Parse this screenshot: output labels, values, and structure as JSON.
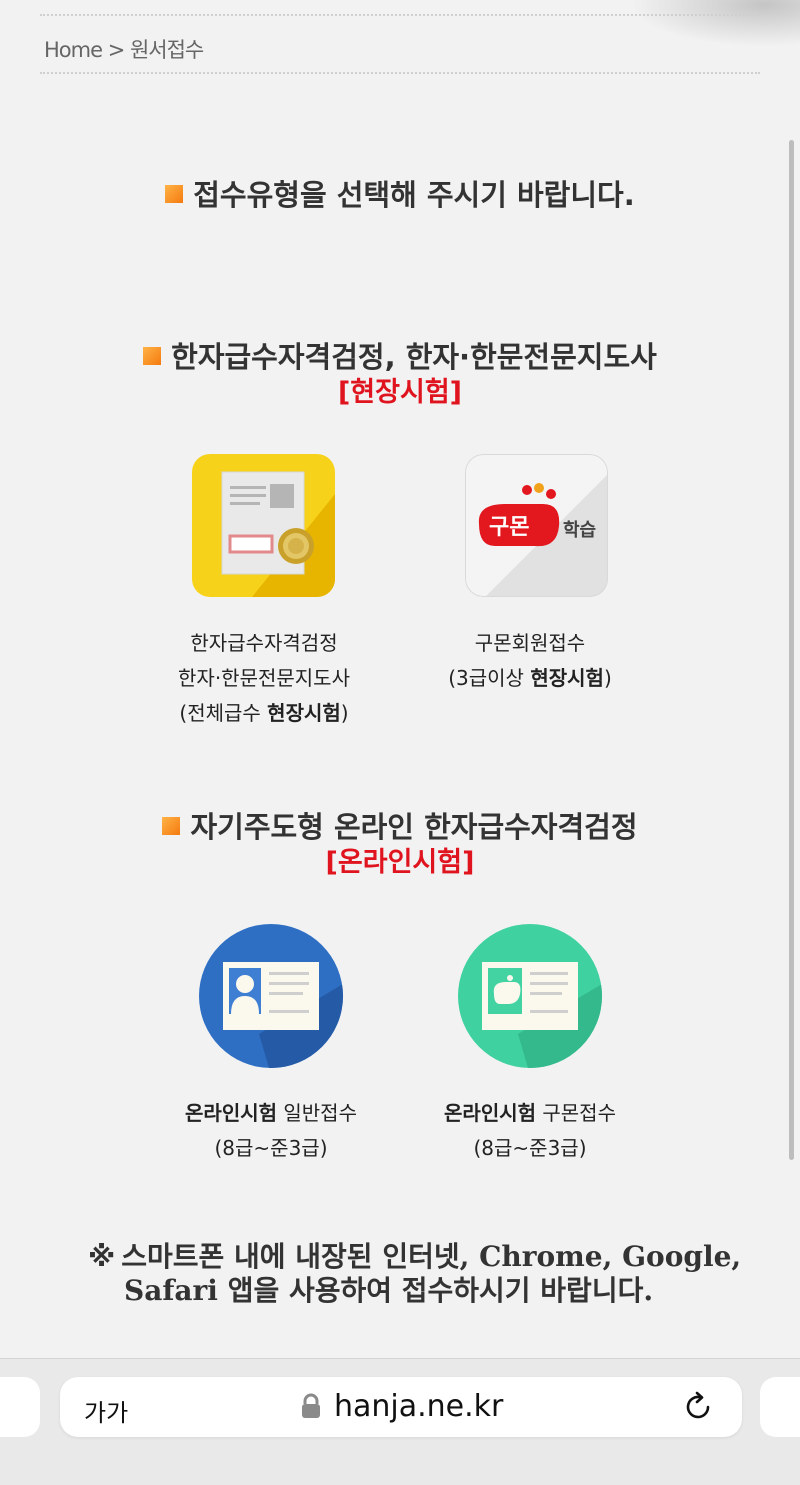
{
  "breadcrumb": {
    "text": "Home > 원서접수"
  },
  "main_heading": "접수유형을 선택해 주시기 바랍니다.",
  "section1": {
    "title": "한자급수자격검정, 한자·한문전문지도사",
    "subtitle": "[현장시험]",
    "tiles": [
      {
        "icon": "document-card-icon",
        "lines": [
          "한자급수자격검정",
          "한자·한문전문지도사"
        ],
        "line3_prefix": "(전체급수 ",
        "line3_bold": "현장시험",
        "line3_suffix": ")"
      },
      {
        "icon": "kumon-logo-icon",
        "logo_text": "구몬",
        "logo_sub": "학습",
        "lines": [
          "구몬회원접수"
        ],
        "line2_prefix": "(3급이상 ",
        "line2_bold": "현장시험",
        "line2_suffix": ")"
      }
    ]
  },
  "section2": {
    "title": "자기주도형 온라인 한자급수자격검정",
    "subtitle": "[온라인시험]",
    "tiles": [
      {
        "icon": "id-card-icon",
        "bold": "온라인시험",
        "rest": " 일반접수",
        "line2": "(8급~준3급)"
      },
      {
        "icon": "kumon-card-icon",
        "bold": "온라인시험",
        "rest": " 구몬접수",
        "line2": "(8급~준3급)"
      }
    ]
  },
  "notice": {
    "mark": "※",
    "line1": "스마트폰 내에 내장된 인터넷, Chrome, Google,",
    "line2": "Safari 앱을 사용하여 접수하시기 바랍니다."
  },
  "browser": {
    "text_size_label": "가가",
    "url": "hanja.ne.kr"
  },
  "colors": {
    "accent_orange": "#f47a0f",
    "accent_red": "#e0141e",
    "tile_yellow": "#f7d21a",
    "tile_blue": "#2e6fc4",
    "tile_green": "#3fd1a0"
  }
}
